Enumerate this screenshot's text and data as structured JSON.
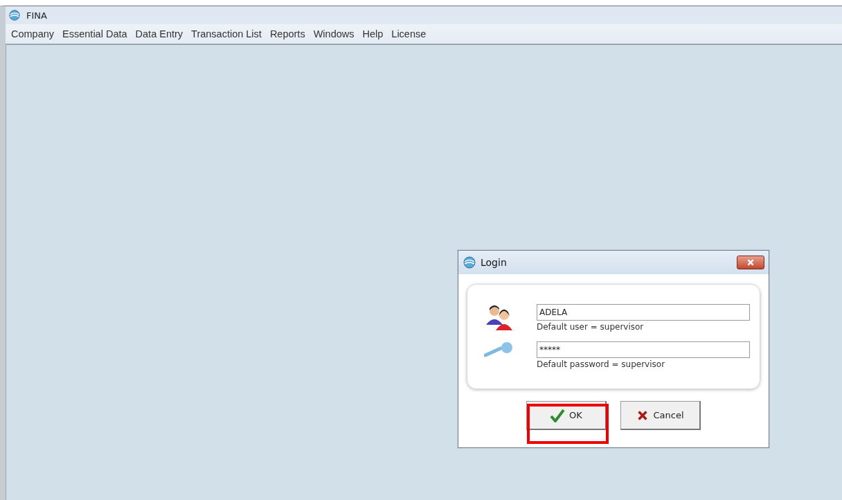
{
  "window": {
    "title": "FINA"
  },
  "menu": [
    "Company",
    "Essential Data",
    "Data Entry",
    "Transaction List",
    "Reports",
    "Windows",
    "Help",
    "License"
  ],
  "dialog": {
    "title": "Login",
    "fields": [
      {
        "kind": "user",
        "value": "ADELA",
        "hint": "Default user = supervisor"
      },
      {
        "kind": "password",
        "value": "*****",
        "hint": "Default password = supervisor"
      }
    ],
    "buttons": [
      {
        "kind": "ok",
        "label": "OK",
        "highlighted": true
      },
      {
        "kind": "cancel",
        "label": "Cancel",
        "highlighted": false
      }
    ]
  }
}
